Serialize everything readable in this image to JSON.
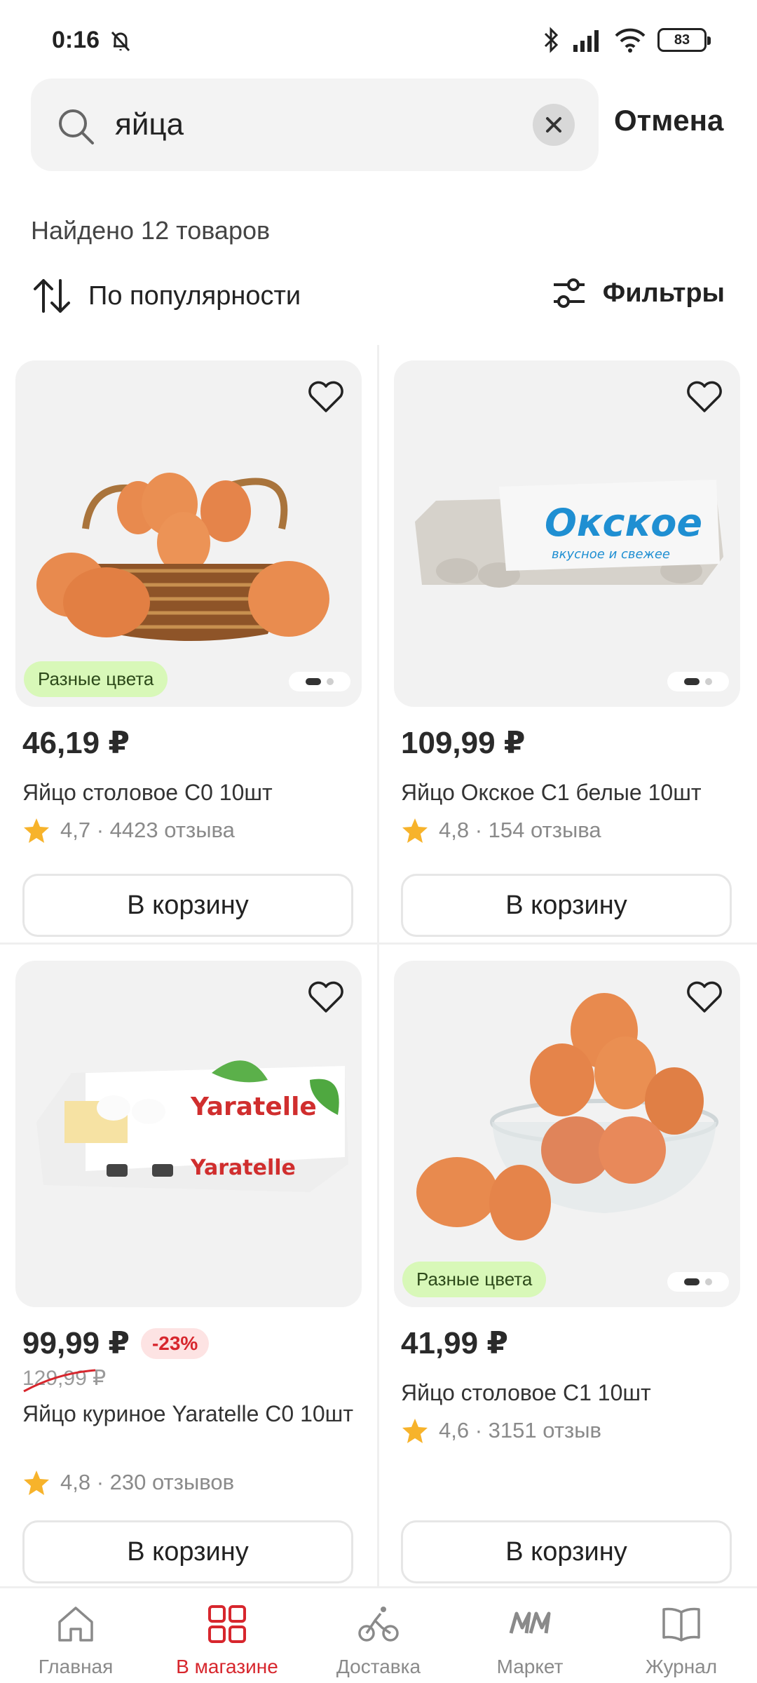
{
  "status_bar": {
    "time": "0:16",
    "battery": "83"
  },
  "search": {
    "value": "яйца",
    "cancel_label": "Отмена"
  },
  "results": {
    "found_text": "Найдено 12 товаров",
    "sort_label": "По популярности",
    "filters_label": "Фильтры"
  },
  "products": [
    {
      "price": "46,19 ₽",
      "title": "Яйцо столовое С0 10шт",
      "rating": "4,7 · 4423 отзыва",
      "tag": "Разные цвета",
      "cart_label": "В корзину"
    },
    {
      "price": "109,99 ₽",
      "title": "Яйцо Окское С1 белые 10шт",
      "rating": "4,8 · 154 отзыва",
      "cart_label": "В корзину",
      "brand_text": "Окское",
      "brand_sub": "вкусное и свежее"
    },
    {
      "price": "99,99 ₽",
      "discount": "-23%",
      "old_price": "129,99 ₽",
      "title": "Яйцо куриное Yaratelle С0 10шт",
      "rating": "4,8 · 230 отзывов",
      "cart_label": "В корзину",
      "brand_text": "Yaratelle"
    },
    {
      "price": "41,99 ₽",
      "title": "Яйцо столовое С1 10шт",
      "rating": "4,6 · 3151 отзыв",
      "tag": "Разные цвета",
      "cart_label": "В корзину"
    }
  ],
  "nav": [
    {
      "label": "Главная",
      "icon": "home-icon"
    },
    {
      "label": "В магазине",
      "icon": "grid-icon",
      "active": true
    },
    {
      "label": "Доставка",
      "icon": "bicycle-icon"
    },
    {
      "label": "Маркет",
      "icon": "market-logo-icon"
    },
    {
      "label": "Журнал",
      "icon": "book-icon"
    }
  ],
  "colors": {
    "accent": "#d7262d",
    "tag_bg": "#d8f8b8",
    "star": "#f7b32b",
    "egg": "#e88a4e"
  }
}
